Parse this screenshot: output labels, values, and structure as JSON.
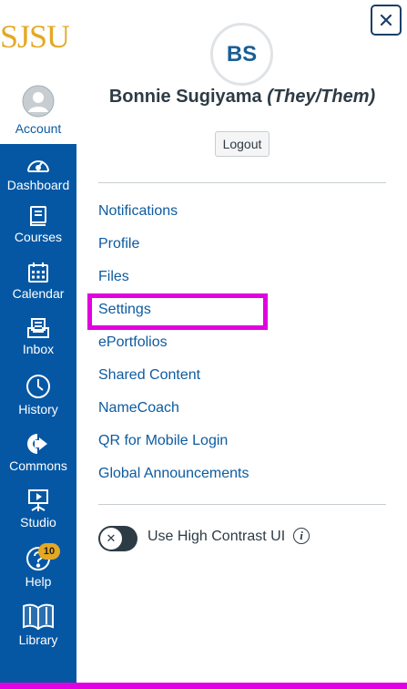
{
  "nav": {
    "logo": "SJSU",
    "account_label": "Account",
    "items": [
      {
        "label": "Dashboard",
        "icon": "dashboard-icon"
      },
      {
        "label": "Courses",
        "icon": "courses-icon"
      },
      {
        "label": "Calendar",
        "icon": "calendar-icon"
      },
      {
        "label": "Inbox",
        "icon": "inbox-icon"
      },
      {
        "label": "History",
        "icon": "history-icon"
      },
      {
        "label": "Commons",
        "icon": "commons-icon"
      },
      {
        "label": "Studio",
        "icon": "studio-icon"
      },
      {
        "label": "Help",
        "icon": "help-icon",
        "badge": "10"
      },
      {
        "label": "Library",
        "icon": "library-icon"
      }
    ],
    "nav_color": "#0557a4",
    "brand_color": "#e5a823"
  },
  "tray": {
    "initials": "BS",
    "name": "Bonnie Sugiyama",
    "pronouns": "(They/Them)",
    "logout_label": "Logout",
    "links": [
      "Notifications",
      "Profile",
      "Files",
      "Settings",
      "ePortfolios",
      "Shared Content",
      "NameCoach",
      "QR for Mobile Login",
      "Global Announcements"
    ],
    "highlighted_link": "Settings",
    "highlight_color": "#e100e1",
    "toggle_label": "Use High Contrast UI",
    "toggle_on": false
  }
}
